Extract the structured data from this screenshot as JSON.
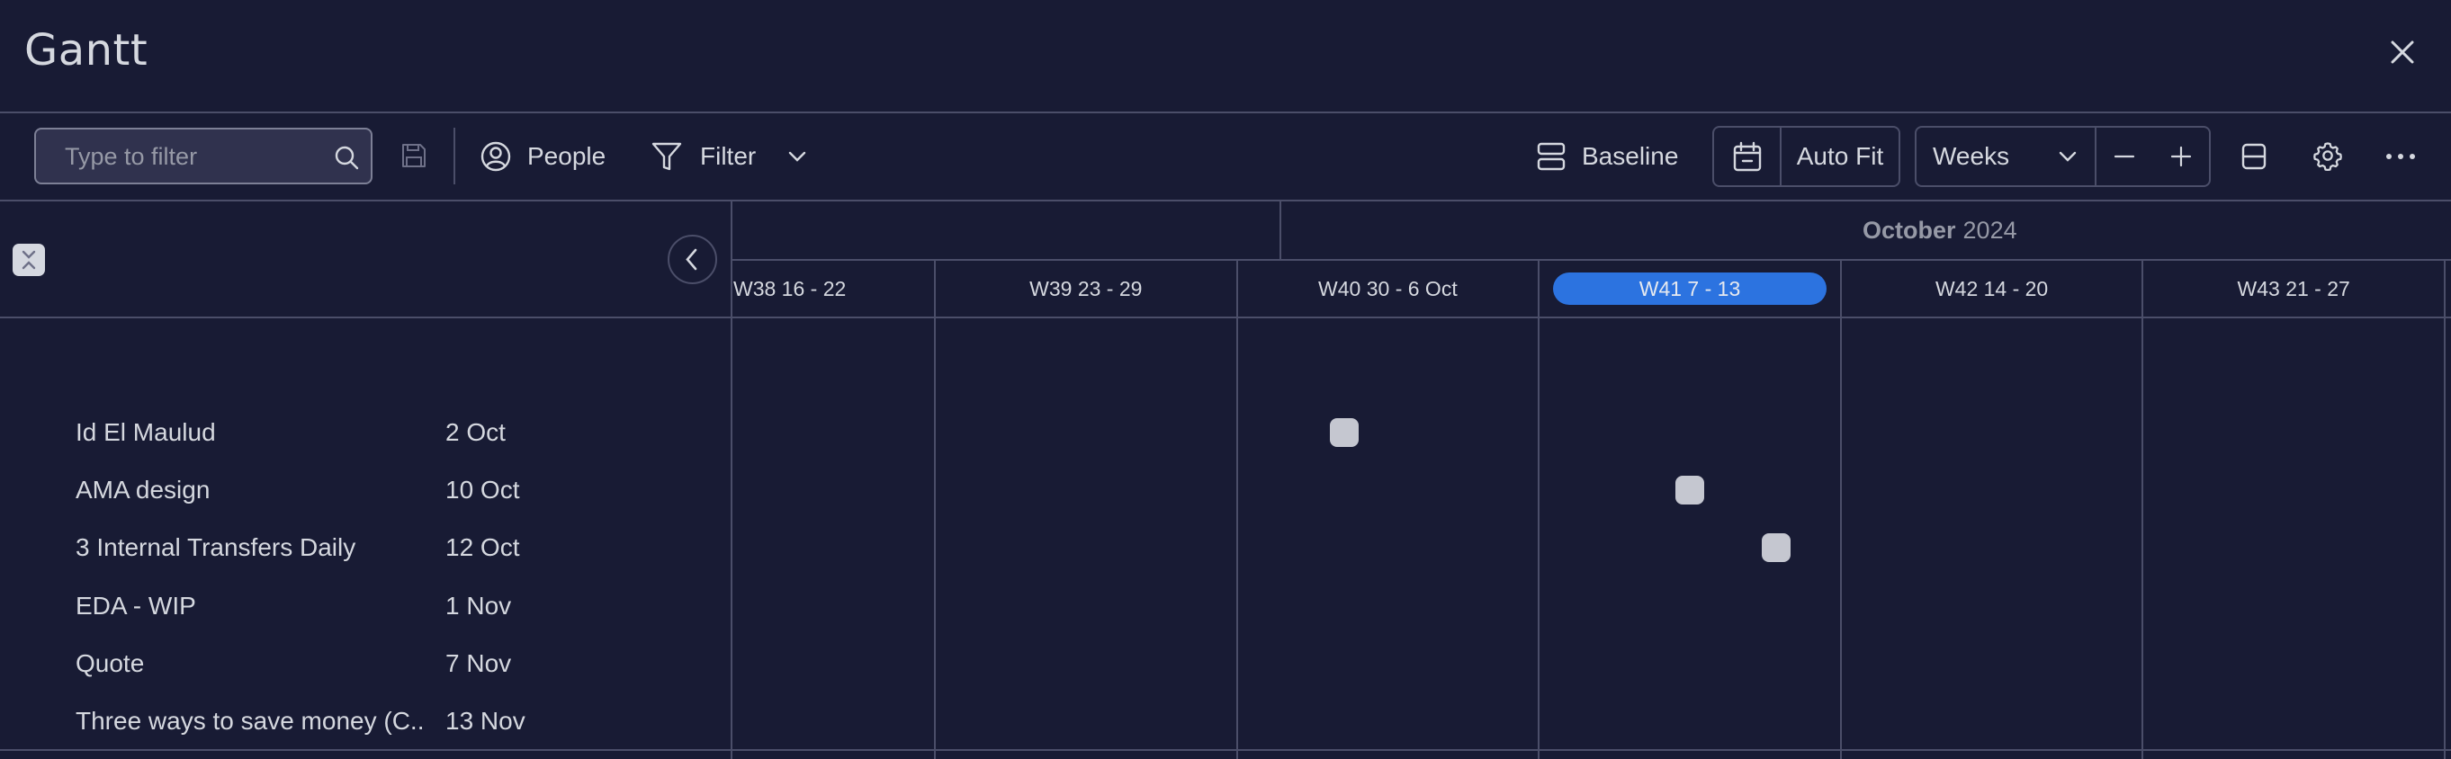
{
  "header": {
    "title": "Gantt",
    "close_icon": "close-icon"
  },
  "toolbar": {
    "search": {
      "placeholder": "Type to filter",
      "value": "",
      "icon": "search-icon"
    },
    "save_icon": "save-icon",
    "people_label": "People",
    "filter_label": "Filter",
    "baseline_label": "Baseline",
    "autofit_label": "Auto Fit",
    "scale_select": {
      "value": "Weeks"
    },
    "zoom_out_icon": "minus-icon",
    "zoom_in_icon": "plus-icon",
    "split_view_icon": "split-rows-icon",
    "settings_icon": "gear-icon",
    "more_icon": "more-dots-icon"
  },
  "timeline": {
    "month": {
      "name": "October",
      "year": "2024"
    },
    "weeks": [
      {
        "label": "W38 16 - 22",
        "current": false
      },
      {
        "label": "W39 23 - 29",
        "current": false
      },
      {
        "label": "W40 30 - 6 Oct",
        "current": false
      },
      {
        "label": "W41 7 - 13",
        "current": true
      },
      {
        "label": "W42 14 - 20",
        "current": false
      },
      {
        "label": "W43 21 - 27",
        "current": false
      }
    ]
  },
  "tasks": [
    {
      "name": "Id El Maulud",
      "date": "2 Oct",
      "day_of_oct": 2
    },
    {
      "name": "AMA design",
      "date": "10 Oct",
      "day_of_oct": 10
    },
    {
      "name": "3 Internal Transfers Daily",
      "date": "12 Oct",
      "day_of_oct": 12
    },
    {
      "name": "EDA - WIP",
      "date": "1 Nov",
      "day_of_oct": 32
    },
    {
      "name": "Quote",
      "date": "7 Nov",
      "day_of_oct": 38
    },
    {
      "name": "Three ways to save money (C...",
      "date": "13 Nov",
      "day_of_oct": 44
    }
  ],
  "colors": {
    "background": "#181b34",
    "accent": "#2c73e0",
    "milestone": "#c5c7d0",
    "grid": "#4b4e69"
  }
}
